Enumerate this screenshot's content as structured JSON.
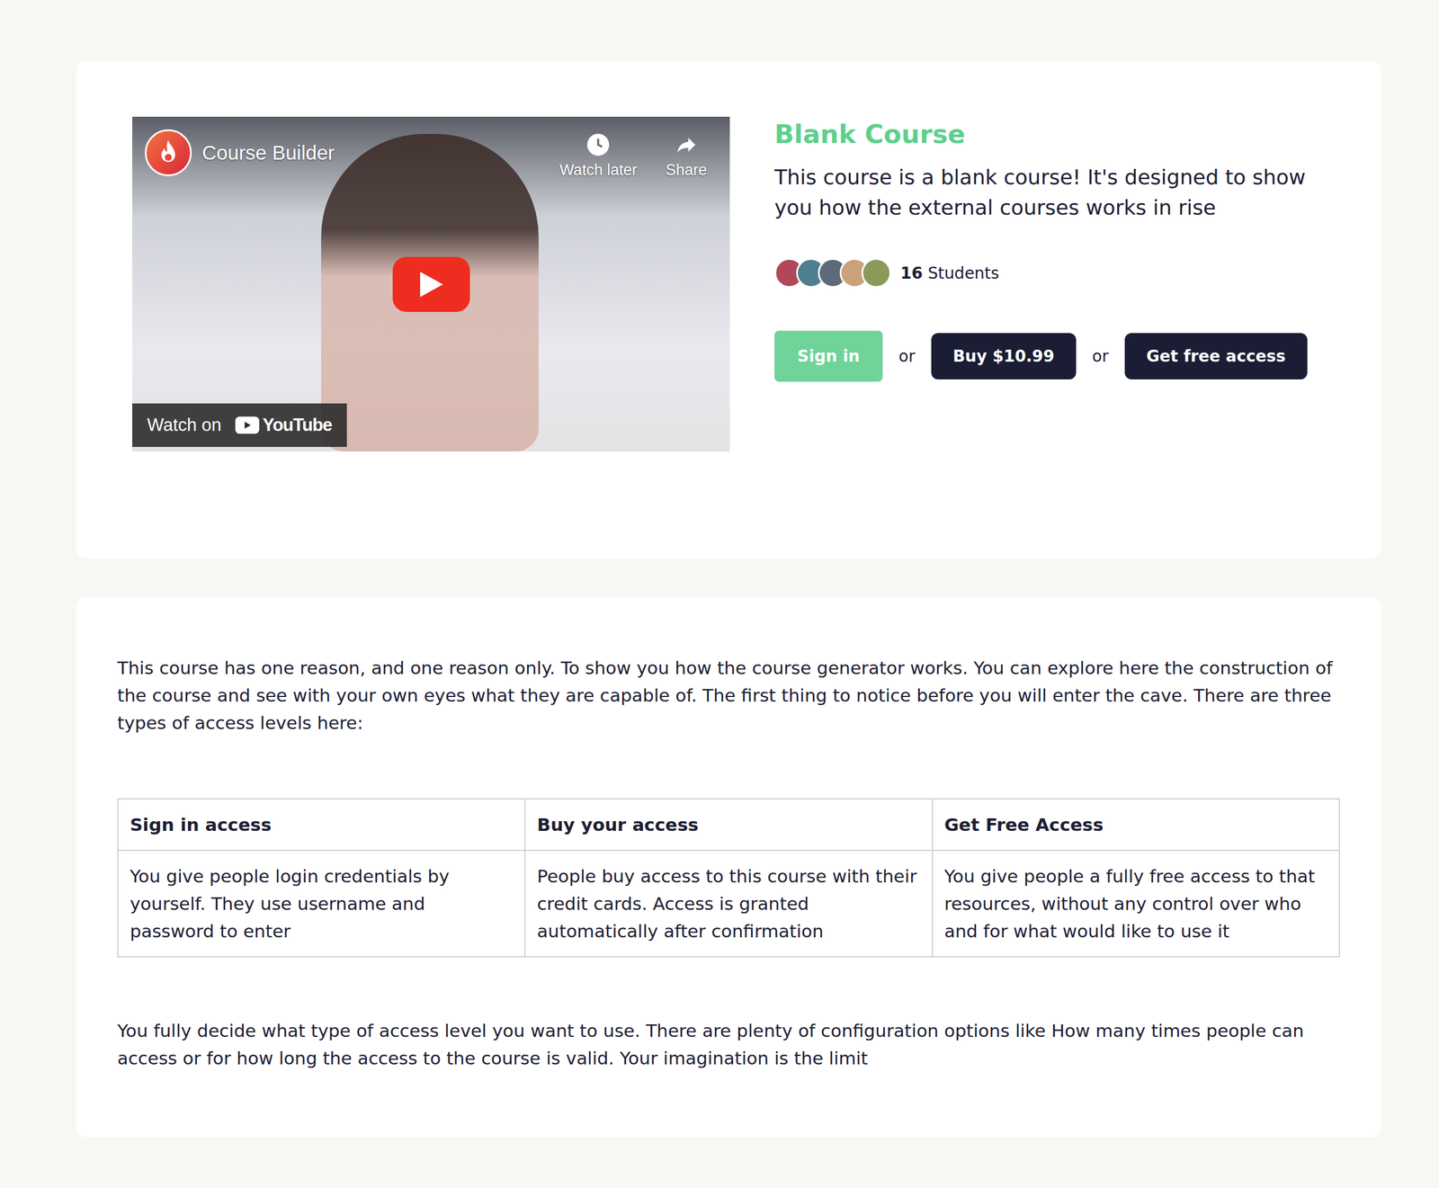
{
  "video": {
    "channel": "Course Builder",
    "actions": [
      {
        "label": "Watch later",
        "kind": "clock"
      },
      {
        "label": "Share",
        "kind": "share"
      }
    ],
    "watch_on": "Watch on",
    "platform": "YouTube"
  },
  "course": {
    "title": "Blank Course",
    "description": "This course is a blank course! It's designed to show you how the external courses works in rise",
    "students": {
      "count": "16",
      "label": "Students",
      "avatars": [
        {
          "color": "#b0485a"
        },
        {
          "color": "#4f7f8f"
        },
        {
          "color": "#5d6a78"
        },
        {
          "color": "#c9a27a"
        },
        {
          "color": "#8a9a5b"
        }
      ]
    }
  },
  "separator": "or",
  "buttons": [
    {
      "label": "Sign in",
      "kind": "primary"
    },
    {
      "label": "Buy $10.99",
      "kind": "dark"
    },
    {
      "label": "Get free access",
      "kind": "dark"
    }
  ],
  "intro": "This course has one reason, and one reason only. To show you how the course generator works. You can explore here the construction of the course and see with your own eyes what they are capable of. The first thing to notice before you will enter the cave. There are three types of access levels here:",
  "table": {
    "columns": [
      "Sign in access",
      "Buy your access",
      "Get Free Access"
    ],
    "rows": [
      [
        "You give people login credentials by yourself. They use username and password to enter",
        "People buy access to this course with their credit cards. Access is granted automatically after confirmation",
        "You give people a fully free access to that resources, without any control over who and for what would like to use it"
      ]
    ]
  },
  "outro": "You fully decide what type of access level you want to use. There are plenty of configuration options like How many times people can access or for how long the access to the course is valid. Your imagination is the limit"
}
